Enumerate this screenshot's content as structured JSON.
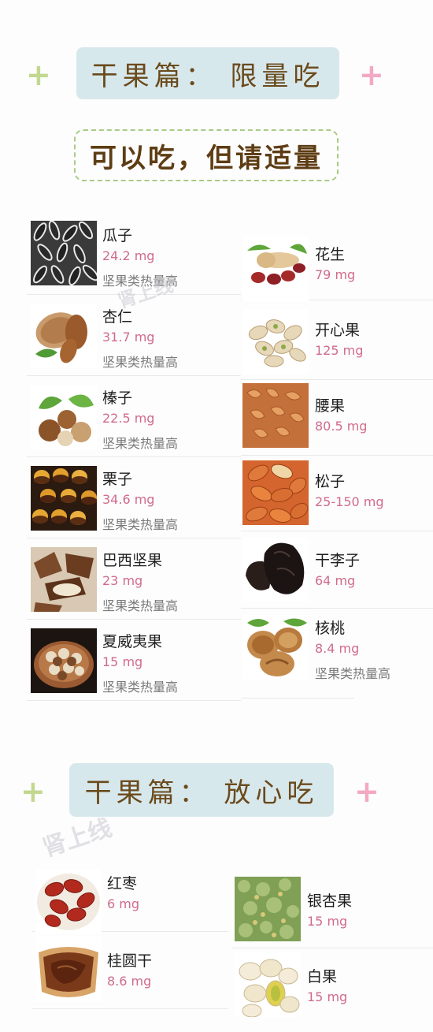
{
  "section1": {
    "title": "干果篇： 限量吃",
    "subtitle": "可以吃，但请适量",
    "left": [
      {
        "name": "瓜子",
        "amount": "24.2 mg",
        "note": "坚果类热量高",
        "icon": "sunflower-seeds"
      },
      {
        "name": "杏仁",
        "amount": "31.7 mg",
        "note": "坚果类热量高",
        "icon": "almond"
      },
      {
        "name": "榛子",
        "amount": "22.5 mg",
        "note": "坚果类热量高",
        "icon": "hazelnut"
      },
      {
        "name": "栗子",
        "amount": "34.6 mg",
        "note": "坚果类热量高",
        "icon": "chestnut"
      },
      {
        "name": "巴西坚果",
        "amount": "23 mg",
        "note": "坚果类热量高",
        "icon": "brazil-nut"
      },
      {
        "name": "夏威夷果",
        "amount": "15 mg",
        "note": "坚果类热量高",
        "icon": "macadamia"
      }
    ],
    "right": [
      {
        "name": "花生",
        "amount": "79 mg",
        "icon": "peanut"
      },
      {
        "name": "开心果",
        "amount": "125 mg",
        "icon": "pistachio"
      },
      {
        "name": "腰果",
        "amount": "80.5 mg",
        "icon": "cashew"
      },
      {
        "name": "松子",
        "amount": "25-150 mg",
        "icon": "pine-nut"
      },
      {
        "name": "干李子",
        "amount": "64 mg",
        "icon": "prune"
      },
      {
        "name": "核桃",
        "amount": "8.4 mg",
        "note": "坚果类热量高",
        "icon": "walnut"
      }
    ]
  },
  "section2": {
    "title": "干果篇： 放心吃",
    "left": [
      {
        "name": "红枣",
        "amount": "6 mg",
        "icon": "red-date"
      },
      {
        "name": "桂圆干",
        "amount": "8.6 mg",
        "icon": "dried-longan"
      }
    ],
    "right": [
      {
        "name": "银杏果",
        "amount": "15 mg",
        "icon": "ginkgo-tree"
      },
      {
        "name": "白果",
        "amount": "15 mg",
        "icon": "ginkgo-nut"
      }
    ]
  },
  "watermark": "肾上线",
  "colors": {
    "title_bg": "#d7e8ec",
    "title_text": "#6b4a1c",
    "amount": "#d16a8b",
    "plus_green": "#c3d88f",
    "plus_pink": "#f3a8c4",
    "dashed_border": "#a8cc86"
  }
}
